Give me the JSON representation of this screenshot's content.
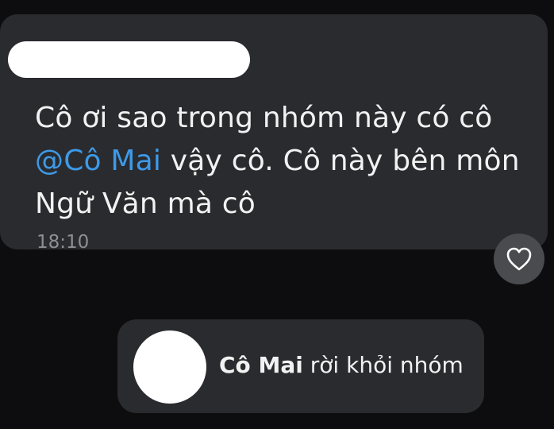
{
  "message": {
    "text_before": "Cô ơi sao trong nhóm này có cô",
    "mention": "@Cô Mai",
    "text_after": " vậy cô. Cô này bên môn Ngữ Văn mà cô",
    "time": "18:10"
  },
  "reaction": {
    "icon": "heart-outline-icon"
  },
  "system_notice": {
    "name": "Cô Mai",
    "action": " rời khỏi nhóm"
  },
  "colors": {
    "background": "#0d0d0f",
    "bubble": "#2a2b2f",
    "mention": "#3d9ae8",
    "text": "#f2f2f2",
    "time": "#8e8f93",
    "redaction": "#ffffff"
  }
}
